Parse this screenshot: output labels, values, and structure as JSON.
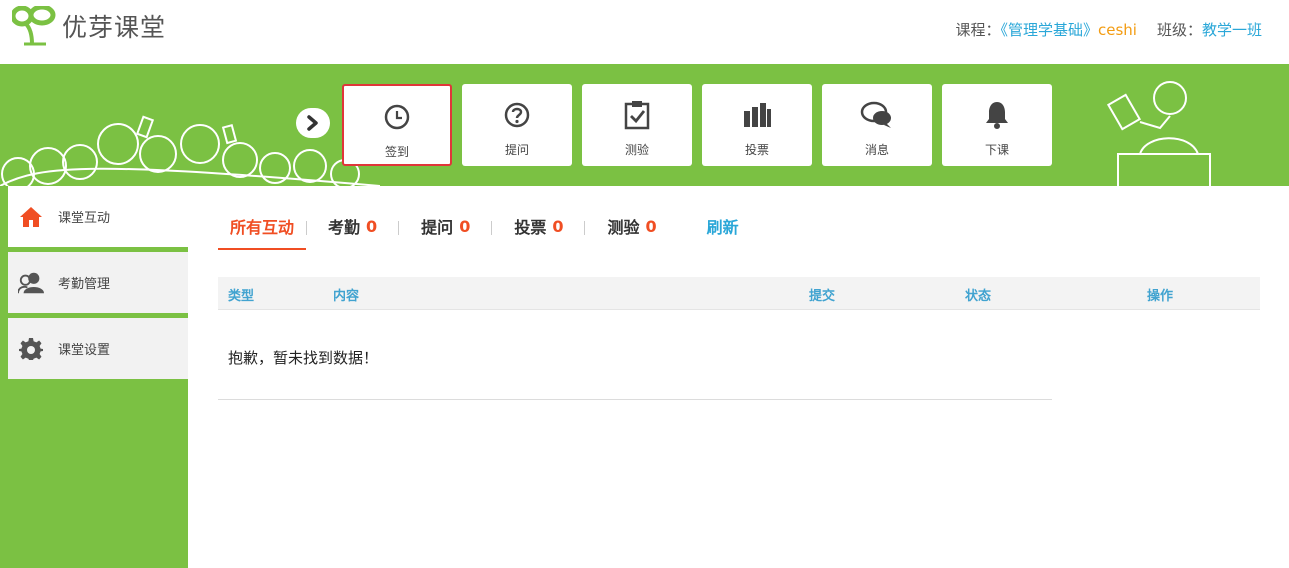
{
  "header": {
    "brand": "优芽课堂",
    "course_label": "课程：",
    "course_name": "《管理学基础》",
    "course_suffix": "ceshi",
    "class_label": "班级：",
    "class_name": "教学一班"
  },
  "toolbar": {
    "tools": [
      {
        "label": "签到",
        "icon": "clock-icon",
        "active": true
      },
      {
        "label": "提问",
        "icon": "question-icon"
      },
      {
        "label": "测验",
        "icon": "clipboard-check-icon"
      },
      {
        "label": "投票",
        "icon": "bar-chart-icon"
      },
      {
        "label": "消息",
        "icon": "chat-icon"
      },
      {
        "label": "下课",
        "icon": "bell-icon"
      }
    ]
  },
  "sidebar": {
    "items": [
      {
        "label": "课堂互动",
        "icon": "home-icon",
        "active": true
      },
      {
        "label": "考勤管理",
        "icon": "users-icon"
      },
      {
        "label": "课堂设置",
        "icon": "gear-icon"
      }
    ]
  },
  "tabs": {
    "all": "所有互动",
    "attendance": {
      "label": "考勤",
      "count": "0"
    },
    "question": {
      "label": "提问",
      "count": "0"
    },
    "vote": {
      "label": "投票",
      "count": "0"
    },
    "quiz": {
      "label": "测验",
      "count": "0"
    },
    "refresh": "刷新"
  },
  "table": {
    "columns": [
      "类型",
      "内容",
      "提交",
      "状态",
      "操作"
    ],
    "empty_text": "抱歉，暂未找到数据！"
  },
  "colors": {
    "green": "#7bc143",
    "accent_orange": "#f04e23",
    "link_blue": "#2aa7d8",
    "highlight_red": "#e0363a"
  }
}
